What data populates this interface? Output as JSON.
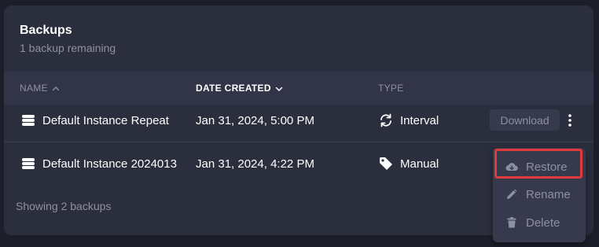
{
  "header": {
    "title": "Backups",
    "subtitle": "1 backup remaining"
  },
  "table": {
    "columns": [
      {
        "label": "NAME",
        "sort": "asc",
        "active": false
      },
      {
        "label": "DATE CREATED",
        "sort": "desc",
        "active": true
      },
      {
        "label": "TYPE",
        "sort": null,
        "active": false
      }
    ],
    "rows": [
      {
        "name": "Default Instance Repeat",
        "date": "Jan 31, 2024, 5:00 PM",
        "type": "Interval",
        "type_icon": "sync-icon"
      },
      {
        "name": "Default Instance 2024013",
        "date": "Jan 31, 2024, 4:22 PM",
        "type": "Manual",
        "type_icon": "tag-icon"
      }
    ]
  },
  "row_actions": {
    "download_label": "Download"
  },
  "context_menu": {
    "items": [
      {
        "label": "Restore",
        "icon": "cloud-download-icon",
        "highlighted": true
      },
      {
        "label": "Rename",
        "icon": "edit-icon"
      },
      {
        "label": "Delete",
        "icon": "trash-icon"
      }
    ]
  },
  "footer": {
    "text": "Showing 2 backups"
  },
  "colors": {
    "background": "#1c1e29",
    "card": "#2b2e3d",
    "header_row": "#323547",
    "muted_text": "#8d90a2",
    "highlight": "#e0393e"
  }
}
